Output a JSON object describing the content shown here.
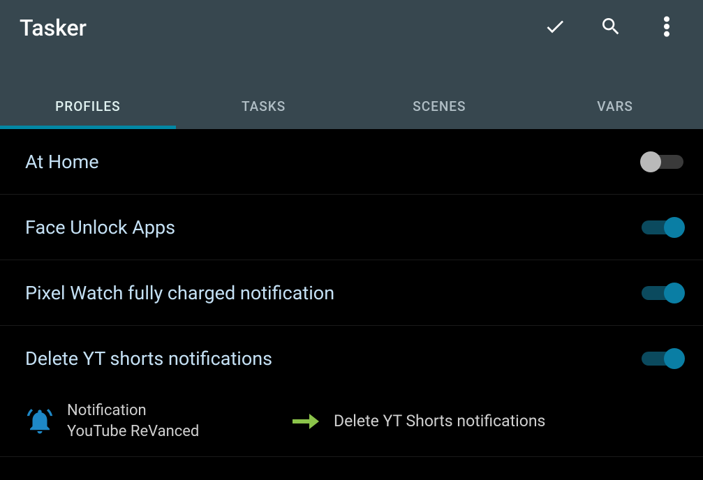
{
  "app": {
    "title": "Tasker"
  },
  "tabs": [
    {
      "label": "PROFILES",
      "active": true
    },
    {
      "label": "TASKS",
      "active": false
    },
    {
      "label": "SCENES",
      "active": false
    },
    {
      "label": "VARS",
      "active": false
    }
  ],
  "profiles": [
    {
      "name": "At Home",
      "enabled": false
    },
    {
      "name": "Face Unlock Apps",
      "enabled": true
    },
    {
      "name": "Pixel Watch fully charged notification",
      "enabled": true
    },
    {
      "name": "Delete YT shorts notifications",
      "enabled": true,
      "expanded": true,
      "context": {
        "type": "Notification",
        "app": "YouTube ReVanced",
        "icon": "bell-icon"
      },
      "task": {
        "name": "Delete YT Shorts notifications"
      }
    }
  ],
  "icons": {
    "check": "check-icon",
    "search": "search-icon",
    "more": "more-vert-icon",
    "arrow": "arrow-right-icon"
  },
  "colors": {
    "header_bg": "#37474f",
    "accent": "#0288a5",
    "profile_text": "#c5e1f5",
    "toggle_on": "#0a7ea4",
    "arrow": "#8bc34a"
  }
}
